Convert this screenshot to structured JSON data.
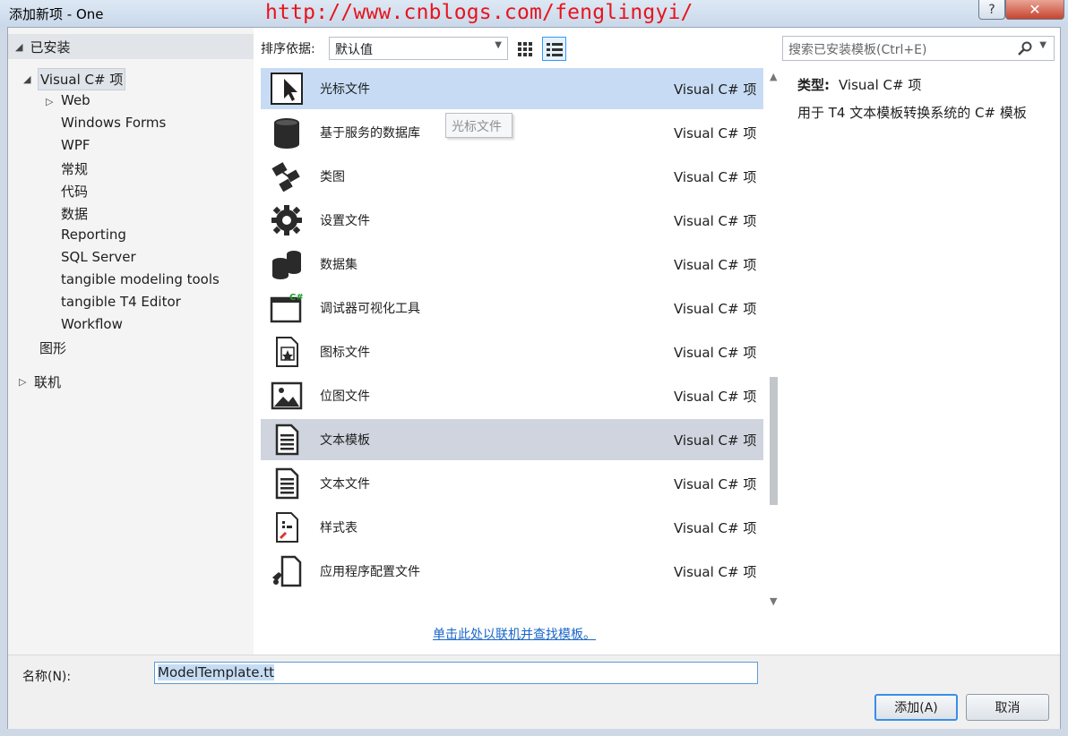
{
  "window": {
    "title": "添加新项 - One",
    "watermark": "http://www.cnblogs.com/fenglingyi/",
    "help_label": "?",
    "close_label": "✕"
  },
  "sidebar": {
    "installed_label": "已安装",
    "tree": [
      {
        "label": "Visual C# 项",
        "level": 0,
        "expanded": true,
        "selected": true
      },
      {
        "label": "Web",
        "level": 1,
        "expandable": true
      },
      {
        "label": "Windows Forms",
        "level": 1
      },
      {
        "label": "WPF",
        "level": 1
      },
      {
        "label": "常规",
        "level": 1
      },
      {
        "label": "代码",
        "level": 1
      },
      {
        "label": "数据",
        "level": 1
      },
      {
        "label": "Reporting",
        "level": 1
      },
      {
        "label": "SQL Server",
        "level": 1
      },
      {
        "label": "tangible modeling tools",
        "level": 1
      },
      {
        "label": "tangible T4 Editor",
        "level": 1
      },
      {
        "label": "Workflow",
        "level": 1
      },
      {
        "label": "图形",
        "level": 0
      }
    ],
    "online_label": "联机"
  },
  "toolbar": {
    "sort_label": "排序依据:",
    "sort_value": "默认值",
    "search_placeholder": "搜索已安装模板(Ctrl+E)"
  },
  "items": [
    {
      "name": "光标文件",
      "type": "Visual C# 项",
      "icon": "cursor-icon",
      "state": "hover"
    },
    {
      "name": "基于服务的数据库",
      "type": "Visual C# 项",
      "icon": "database-icon"
    },
    {
      "name": "类图",
      "type": "Visual C# 项",
      "icon": "class-diagram-icon"
    },
    {
      "name": "设置文件",
      "type": "Visual C# 项",
      "icon": "settings-gear-icon"
    },
    {
      "name": "数据集",
      "type": "Visual C# 项",
      "icon": "dataset-icon"
    },
    {
      "name": "调试器可视化工具",
      "type": "Visual C# 项",
      "icon": "debugger-visualizer-icon"
    },
    {
      "name": "图标文件",
      "type": "Visual C# 项",
      "icon": "icon-file-icon"
    },
    {
      "name": "位图文件",
      "type": "Visual C# 项",
      "icon": "bitmap-icon"
    },
    {
      "name": "文本模板",
      "type": "Visual C# 项",
      "icon": "text-template-icon",
      "state": "selected"
    },
    {
      "name": "文本文件",
      "type": "Visual C# 项",
      "icon": "text-file-icon"
    },
    {
      "name": "样式表",
      "type": "Visual C# 项",
      "icon": "stylesheet-icon"
    },
    {
      "name": "应用程序配置文件",
      "type": "Visual C# 项",
      "icon": "app-config-icon"
    }
  ],
  "tooltip": "光标文件",
  "description": {
    "type_label": "类型:",
    "type_value": "Visual C# 项",
    "text": "用于 T4 文本模板转换系统的 C# 模板"
  },
  "online_link": "单击此处以联机并查找模板。",
  "footer": {
    "name_label": "名称(N):",
    "name_value": "ModelTemplate.tt",
    "add_label": "添加(A)",
    "cancel_label": "取消"
  }
}
